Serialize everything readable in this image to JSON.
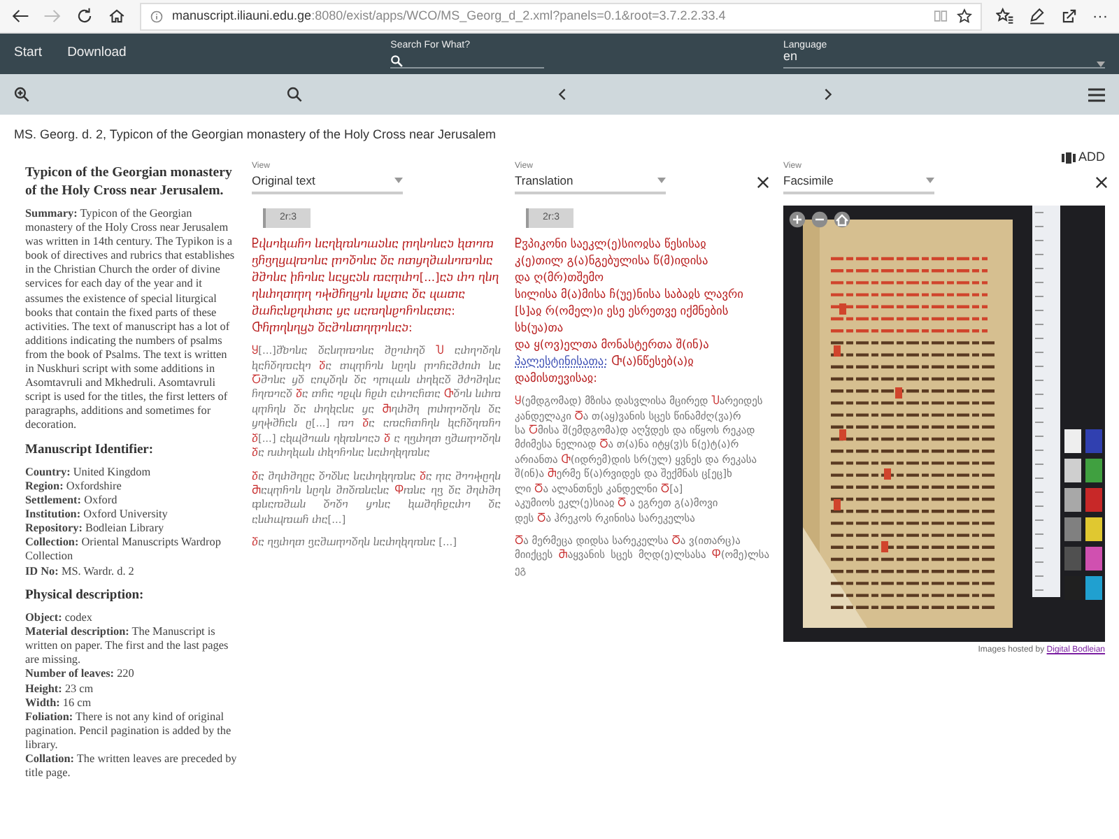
{
  "browser": {
    "url_host": "manuscript.iliauni.edu.ge",
    "url_rest": ":8080/exist/apps/WCO/MS_Georg_d_2.xml?panels=0.1&root=3.7.2.2.33.4",
    "more": "···"
  },
  "navbar": {
    "links": [
      "Start",
      "Download"
    ],
    "search_label": "Search For What?",
    "language_label": "Language",
    "language": "en"
  },
  "document_title": "MS. Georg. d. 2, Typicon of the Georgian monastery of the Holy Cross near Jerusalem",
  "add_button": "ADD",
  "description": {
    "title": "Typicon of the Georgian monastery of the Holy Cross near Jerusalem.",
    "summary": {
      "label": "Summary:",
      "text": "Typicon of the Georgian monastery of the Holy Cross near Jerusalem was written in 14th century. The Typikon is a book of directives and rubrics that establishes in the Christian Church the order of divine services for each day of the year and it assumes the existence of special liturgical books that contain the fixed parts of these activities. The text of manuscript has a lot of additions indicating the numbers of psalms from the book of Psalms. The text is written in Nuskhuri script with some additions in Asomtavruli and Mkhedruli. Asomtavruli script is used for the titles, the first letters of paragraphs, additions and sometimes for decoration."
    },
    "sections": [
      {
        "heading": "Manuscript Identifier:",
        "fields": [
          {
            "label": "Country:",
            "value": "United Kingdom"
          },
          {
            "label": "Region:",
            "value": "Oxfordshire"
          },
          {
            "label": "Settlement:",
            "value": "Oxford"
          },
          {
            "label": "Institution:",
            "value": "Oxford University"
          },
          {
            "label": "Repository:",
            "value": "Bodleian Library"
          },
          {
            "label": "Collection:",
            "value": "Oriental Manuscripts Wardrop Collection"
          },
          {
            "label": "ID No:",
            "value": "MS. Wardr. d. 2"
          }
        ]
      },
      {
        "heading": "Physical description:",
        "fields": [
          {
            "label": "Object:",
            "value": "codex"
          },
          {
            "label": "Material description:",
            "value": "The Manuscript is written on paper. The first and the last pages are missing."
          },
          {
            "label": "Number of leaves:",
            "value": "220"
          },
          {
            "label": "Height:",
            "value": "23 cm"
          },
          {
            "label": "Width:",
            "value": "16 cm"
          },
          {
            "label": "Foliation:",
            "value": "There is not any kind of original pagination. Pencil pagination is added by the library."
          },
          {
            "label": "Collation:",
            "value": "The written leaves are preceded by title page."
          }
        ]
      }
    ]
  },
  "panels": [
    {
      "kind": "text",
      "view_label": "View",
      "view": "Original text",
      "closable": false,
      "folio": "2r:3",
      "blocks": [
        {
          "kind": "heading",
          "segments": [
            {
              "kind": "rubric",
              "text": "Ⴒⴣⴎⴈⴉⴍⴌⴈ ⴑⴀⴄⴉⴊⴑⴈⴍⴢⴑⴀ ⴜⴄⴑⴈⴑⴀⴢ ⴉⴇⴈⴊ ⴂⴌⴂⴄⴁⴓⴊⴈⴑⴀ ⴜⴈⴃⴈⴑⴀ ⴃⴀ ⴖⴇⴘⴄⴋⴍⴑⴈⴊⴈⴑⴀ ⴋⴋⴈⴑⴀ ⴙⴌⴈⴑⴀ ⴑⴀⴁⴀⴢⴑ ⴊⴀⴅⴐⴈ[...]ⴀⴢ ⴐⴈ ⴄⴑⴄ ⴄⴑⴐⴄⴇⴅⴄ ⴈⴕⴋⴌⴄⴁⴈⴑ ⴑⴞⴇⴀ ⴃⴀ ⴗⴍⴇⴀ ⴋⴍⴌⴀⴑⴒⴄⴐⴇⴀ ⴘⴀ ⴎⴀⴊⴄⴑⴒⴈⴌⴈⴑⴀⴇⴀ: Ⴇⴌⴜⴄⴑⴄⴁⴢ ⴃⴀⴋⴈⴑⴇⴄⴅⴈⴑⴀⴢ:"
            }
          ]
        },
        {
          "kind": "body",
          "segments": [
            {
              "kind": "initial",
              "text": "Ⴘ"
            },
            {
              "kind": "plain",
              "text": "[...]ⴋⴆⴈⴑⴀ ⴃⴀⴑⴅⴊⴈⴑⴀ ⴋⴚⴈⴐⴄⴃ "
            },
            {
              "kind": "initial",
              "text": "Ⴎ"
            },
            {
              "kind": "plain",
              "text": " ⴀⴐⴄⴈⴃⴄⴑ ⴉⴀⴌⴃⴄⴊⴀⴉⴈ "
            },
            {
              "kind": "initial",
              "text": "ⴃ"
            },
            {
              "kind": "plain",
              "text": "ⴀ ⴇⴗⴅⴌⴈⴑ ⴑⴚⴄⴑ ⴜⴈⴌⴀⴋⴛⴖⴐ ⴑⴀ "
            },
            {
              "kind": "initial",
              "text": "Ⴀ"
            },
            {
              "kind": "plain",
              "text": "ⴋⴈⴑⴀ ⴘⴃ ⴀⴖⴤⴃⴄⴑ ⴃⴀ ⴈⴜⴗⴍⴑ ⴐⴄⴉⴀⴃ ⴋⴛⴈⴋⴄⴑⴀ ⴌⴄⴊⴈⴀⴃ "
            },
            {
              "kind": "initial",
              "text": "ⴃ"
            },
            {
              "kind": "plain",
              "text": "ⴀ ⴇⴌⴀ ⴈⴒⴗⴑ ⴌⴒⴐ ⴀⴐⴈⴀⴌⴇⴀ "
            },
            {
              "kind": "initial",
              "text": "Ⴇ"
            },
            {
              "kind": "plain",
              "text": "ⴃⴈⴑ ⴑⴐⴊ ⴗⴅⴌⴄⴑ ⴃⴀ ⴐⴄⴉⴀⴑⴀ ⴘⴀ "
            },
            {
              "kind": "initial",
              "text": "Ⴋ"
            },
            {
              "kind": "plain",
              "text": "ⴄⴐⴋⴄ ⴜⴐⴅⴈⴃⴄⴑ ⴃⴀ ⴘⴄⴕⴋⴌⴀⴑ ⴚ[...] ⴊⴈ "
            },
            {
              "kind": "initial",
              "text": "ⴃ"
            },
            {
              "kind": "plain",
              "text": "ⴀ ⴀⴊⴀⴌⴇⴌⴄⴑ ⴉⴀⴌⴃⴄⴊⴌⴈ "
            },
            {
              "kind": "initial",
              "text": "ⴃ"
            },
            {
              "kind": "plain",
              "text": "[...] ⴀⴉⴓⴋⴈⴍⴑ ⴄⴉⴊⴑⴈⴀⴢ "
            },
            {
              "kind": "initial",
              "text": "ⴃ"
            },
            {
              "kind": "plain",
              "text": " ⴀ ⴄⴂⴐⴄⴇ ⴂⴋⴍⴅⴈⴃⴄⴑ "
            },
            {
              "kind": "initial",
              "text": "ⴃ"
            },
            {
              "kind": "plain",
              "text": "ⴀ ⴠⴐⴄⴉⴍⴑ ⴐⴉⴈⴌⴈⴑⴀ ⴑⴀⴐⴄⴉⴄⴊⴑⴀ"
            }
          ]
        },
        {
          "kind": "body",
          "segments": [
            {
              "kind": "initial",
              "text": "ⴃ"
            },
            {
              "kind": "plain",
              "text": "ⴀ ⴋⴄⴐⴋⴄⴚⴀ ⴃⴈⴃⴑⴀ ⴑⴀⴐⴄⴉⴄⴊⴑⴀ "
            },
            {
              "kind": "initial",
              "text": "ⴃ"
            },
            {
              "kind": "plain",
              "text": "ⴀ ⴅⴀ ⴋⴈⴈⴕⴚⴄⴑ "
            },
            {
              "kind": "initial",
              "text": "Ⴋ"
            },
            {
              "kind": "plain",
              "text": "ⴀⴗⴅⴌⴈⴑ ⴑⴚⴄⴑ ⴋⴖⴃⴊⴑⴀⴑⴀ "
            },
            {
              "kind": "initial",
              "text": "Ⴔ"
            },
            {
              "kind": "plain",
              "text": "ⴊⴑⴀ ⴄⴂ ⴃⴀ ⴋⴄⴐⴋⴄ ⴔⴑⴀⴊⴋⴍⴑ ⴃⴈⴃⴈ ⴘⴈⴑⴀ ⴉⴍⴋⴄⴌⴒⴀⴐⴈ ⴃⴀ ⴀⴑⴐⴓⴊⴍⴌ ⴐⴀ[...]"
            }
          ]
        },
        {
          "kind": "body",
          "segments": [
            {
              "kind": "initial",
              "text": "ⴃ"
            },
            {
              "kind": "plain",
              "text": "ⴀ ⴄⴂⴐⴄⴇ ⴂⴀⴋⴍⴅⴈⴃⴄⴑ ⴑⴀⴐⴄⴉⴄⴊⴑⴀ [...]"
            }
          ]
        }
      ]
    },
    {
      "kind": "text",
      "view_label": "View",
      "view": "Translation",
      "closable": true,
      "folio": "2r:3",
      "blocks": [
        {
          "kind": "heading",
          "segments": [
            {
              "kind": "rubric",
              "text": "Ⴒჳპიკონი საეკლ(ე)სიოჲსა წესისაჲ\nკ(ე)თილ გ(ა)ნგებულისა წ(მ)იდისა\nდა ღ(მრ)თშემო\nსილისა მ(ა)მისა ჩ(უე)ნისა საბაჲს ლავრი\n[ს]აჲ რ(ომელ)ი ესე ესრეთვე იქმნების სხ(უა)თა\nდა ყ(ოვ)ელთა მონასტერთა შ(ინ)ა "
            },
            {
              "kind": "place",
              "text": "პალესტინისათა:"
            },
            {
              "kind": "rubric",
              "text": " Ⴇ(ა)ნწესებ(ა)ჲ დამისთევისაჲ:"
            }
          ]
        },
        {
          "kind": "body",
          "segments": [
            {
              "kind": "initial",
              "text": "Ⴘ"
            },
            {
              "kind": "plain",
              "text": "(ემდგომად) მზისა დასვლისა მცირედ "
            },
            {
              "kind": "initial",
              "text": "Ⴎ"
            },
            {
              "kind": "plain",
              "text": "არეიდეს\nკანდელაკი "
            },
            {
              "kind": "initial",
              "text": "Ⴃ"
            },
            {
              "kind": "plain",
              "text": "ა თ(აყ)ვანის სცეს წინამძღ(ჳა)რ\nსა "
            },
            {
              "kind": "initial",
              "text": "Ⴀ"
            },
            {
              "kind": "plain",
              "text": "მისა შ(ემდგომა)დ აღჴდეს და იწყოს რეკად\nმძიმესა ნელიად "
            },
            {
              "kind": "initial",
              "text": "Ⴃ"
            },
            {
              "kind": "plain",
              "text": "ა თ(ა)ნა იტყ(ჳ)ს ნ(ე)ტ(ა)რ\nარიანთა "
            },
            {
              "kind": "initial",
              "text": "Ⴇ"
            },
            {
              "kind": "plain",
              "text": "(იდრემ)დის სრ(ულ) ყვნეს და რეკასა\nშ(ინ)ა "
            },
            {
              "kind": "initial",
              "text": "Ⴋ"
            },
            {
              "kind": "plain",
              "text": "ერმე წ(ა)რვიდეს და შექმნას ც[ეც]ხ\nლი "
            },
            {
              "kind": "initial",
              "text": "Ⴃ"
            },
            {
              "kind": "plain",
              "text": "ა ალანთნეს კანდელნი "
            },
            {
              "kind": "initial",
              "text": "Ⴃ"
            },
            {
              "kind": "plain",
              "text": "[ა]\nაკუმიოს ეკლ(ე)სიაჲ "
            },
            {
              "kind": "initial",
              "text": "Ⴃ"
            },
            {
              "kind": "plain",
              "text": " ა ეგრეთ გ(ა)მოვი\nდეს "
            },
            {
              "kind": "initial",
              "text": "Ⴃ"
            },
            {
              "kind": "plain",
              "text": "ა ჰრეკოს რკინისა სარეკელსა"
            }
          ]
        },
        {
          "kind": "body",
          "segments": [
            {
              "kind": "initial",
              "text": "Ⴃ"
            },
            {
              "kind": "plain",
              "text": "ა მერმეცა დიდსა სარეკელსა "
            },
            {
              "kind": "initial",
              "text": "Ⴃ"
            },
            {
              "kind": "plain",
              "text": "ა ვ(ითარც)ა\nმიიქცეს "
            },
            {
              "kind": "initial",
              "text": "Ⴋ"
            },
            {
              "kind": "plain",
              "text": "აყვანის სცეს მღდ(ე)ლსასა "
            },
            {
              "kind": "initial",
              "text": "Ⴔ"
            },
            {
              "kind": "plain",
              "text": "(ომე)ლსა ეგ"
            }
          ]
        }
      ]
    },
    {
      "kind": "facsimile",
      "view_label": "View",
      "view": "Facsimile",
      "closable": true,
      "credit": "Images hosted by ",
      "credit_link": "Digital Bodleian"
    }
  ]
}
